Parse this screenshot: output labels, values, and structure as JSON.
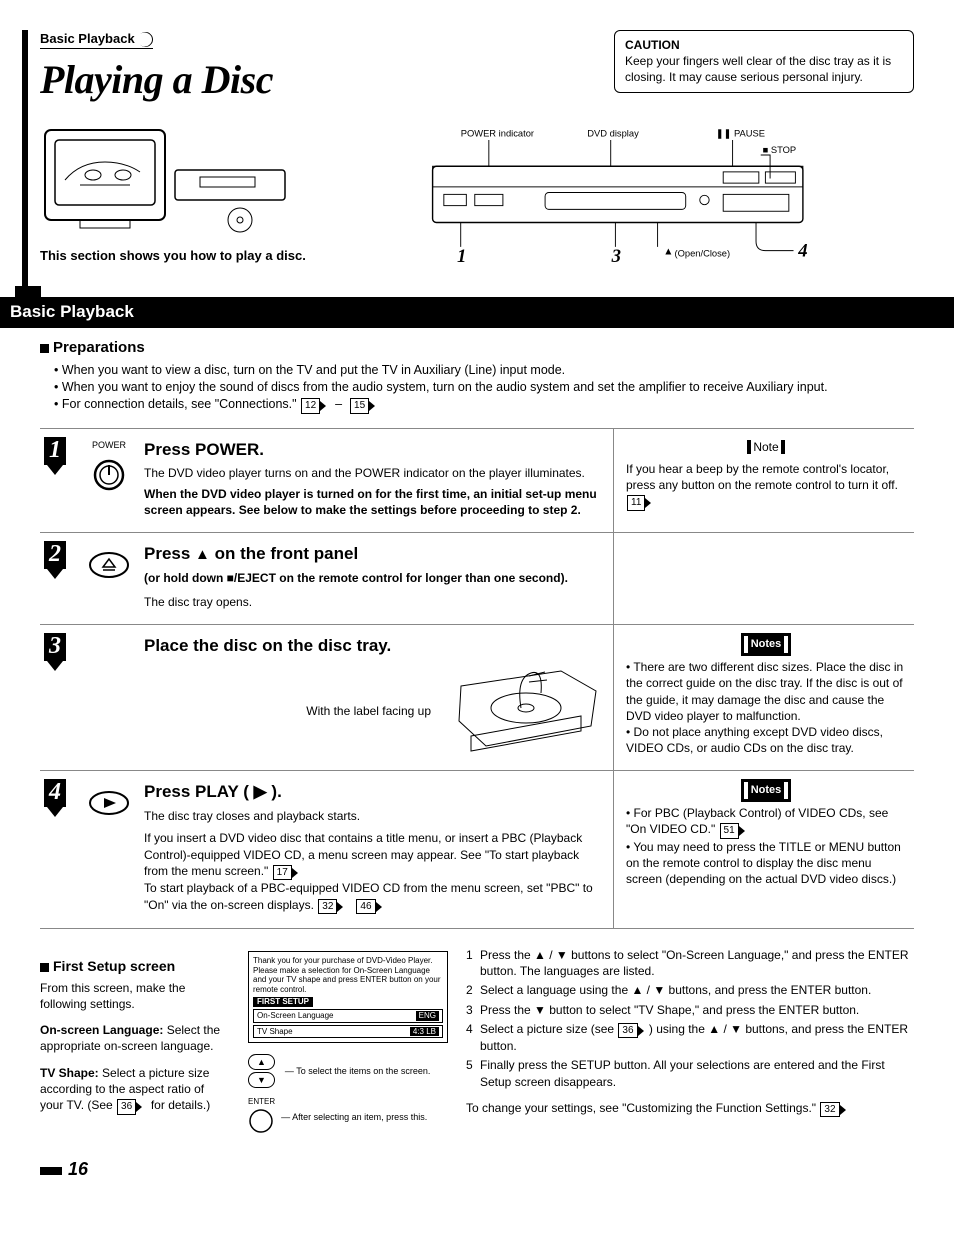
{
  "breadcrumb": "Basic Playback",
  "title": "Playing a Disc",
  "caution": {
    "heading": "CAUTION",
    "body": "Keep your fingers well clear of the disc tray as it is closing. It may cause serious personal injury."
  },
  "intro": "This section shows you how to play a disc.",
  "player_labels": {
    "power_indicator": "POWER indicator",
    "dvd_display": "DVD display",
    "pause": "PAUSE",
    "stop": "STOP",
    "open_close": "(Open/Close)",
    "num1": "1",
    "num3": "3",
    "num4": "4"
  },
  "section_bar": "Basic Playback",
  "preparations": {
    "heading": "Preparations",
    "items": [
      "When you want to view a disc, turn on the TV and put the TV in Auxiliary (Line) input mode.",
      "When you want to enjoy the sound of discs from the audio system, turn on the audio system and set the amplifier to receive Auxiliary input.",
      "For connection details, see \"Connections.\""
    ],
    "refs": [
      "12",
      "15"
    ]
  },
  "steps": [
    {
      "num": "1",
      "icon_label": "POWER",
      "title": "Press POWER.",
      "body1": "The DVD video player turns on and the POWER indicator on the player illuminates.",
      "body2": "When the DVD video player is turned on for the first time, an initial set-up menu screen appears.  See below to make the settings before proceeding to step 2.",
      "note_label": "Note",
      "note_body": "If you hear a beep by the remote control's locator, press any button on the remote control to turn it off.",
      "note_ref": "11"
    },
    {
      "num": "2",
      "title_pre": "Press ",
      "title_post": " on the front panel",
      "sub": "(or hold down ■/EJECT on the remote control for longer than one second).",
      "body1": "The disc tray opens."
    },
    {
      "num": "3",
      "title": "Place the disc on the disc tray.",
      "caption": "With the label facing up",
      "note_label": "Notes",
      "note_items": [
        "There are two different disc sizes. Place the disc in the correct guide on the disc tray. If the disc is out of the guide, it may damage the disc and cause the DVD video player to malfunction.",
        "Do not place anything except DVD video discs, VIDEO CDs, or audio CDs on the disc tray."
      ]
    },
    {
      "num": "4",
      "title": "Press PLAY ( ▶ ).",
      "body1": "The disc tray closes and playback starts.",
      "body2": "If you insert a DVD video disc that contains a title menu, or insert a PBC (Playback Control)-equipped VIDEO CD, a menu screen may appear. See \"To start playback from the menu screen.\"",
      "body3": "To start playback of a PBC-equipped VIDEO CD from the menu screen, set \"PBC\" to \"On\" via the on-screen displays.",
      "ref_a": "17",
      "ref_b": "32",
      "ref_c": "46",
      "note_label": "Notes",
      "note_items": [
        "For PBC (Playback Control) of VIDEO CDs, see \"On VIDEO CD.\"",
        "You may need to press the TITLE or MENU button on the remote control to display the disc menu screen (depending on the actual DVD video discs.)"
      ],
      "note_ref": "51"
    }
  ],
  "first_setup": {
    "heading": "First Setup screen",
    "p1": "From this screen, make the following settings.",
    "p2a": "On-screen Language:",
    "p2b": " Select the appropriate on-screen language.",
    "p3a": "TV Shape:",
    "p3b": " Select a picture size according to the aspect ratio of your TV.  (See ",
    "p3_ref": "36",
    "p3c": " for details.)",
    "box": {
      "l1": "Thank you for your purchase of DVD-Video Player.",
      "l2": "Please make a selection for On-Screen Language and your TV shape and press ENTER button on your remote control.",
      "hdr": "FIRST SETUP",
      "r1a": "On-Screen Language",
      "r1b": "ENG",
      "r2a": "TV Shape",
      "r2b": "4:3 LB"
    },
    "nav1": "To select the items on the screen.",
    "nav2_label": "ENTER",
    "nav2": "After selecting an item, press this.",
    "list": [
      "Press the ▲ / ▼ buttons to select \"On-Screen Language,\" and press the ENTER button.  The languages are listed.",
      "Select a language using the ▲ / ▼ buttons, and press the ENTER button.",
      "Press the ▼ button to select \"TV Shape,\" and press the ENTER button.",
      "Select a picture size (see 36 ) using the ▲ / ▼ buttons, and press the ENTER button.",
      "Finally press the SETUP button.  All your selections are entered and the First Setup screen disappears."
    ],
    "list_ref": "36",
    "tail": "To change your settings, see \"Customizing the Function Settings.\"",
    "tail_ref": "32"
  },
  "page_number": "16"
}
